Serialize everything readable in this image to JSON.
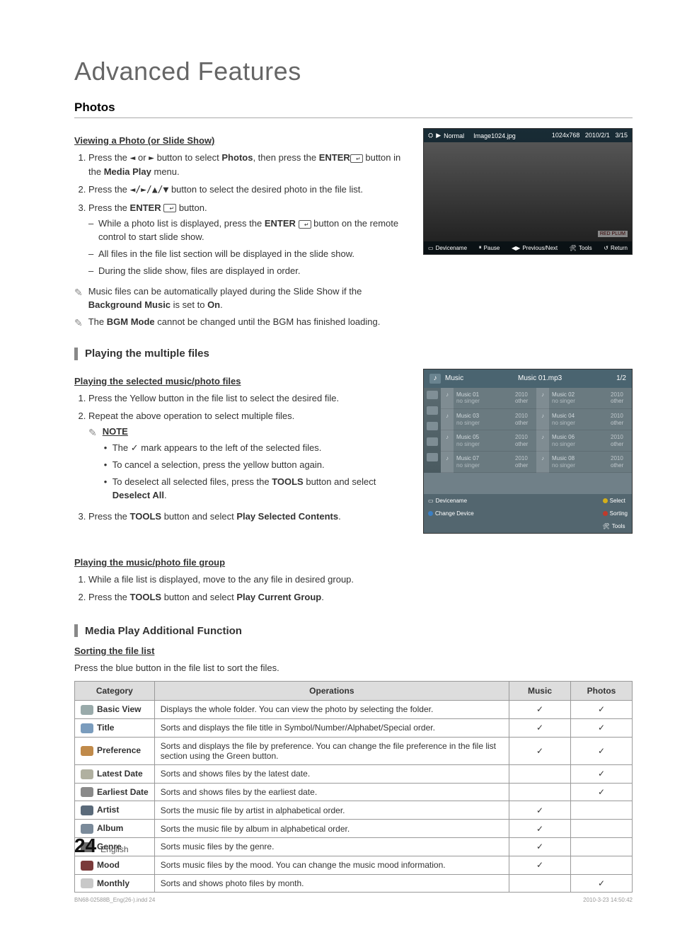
{
  "page": {
    "main_title": "Advanced Features",
    "number": "24",
    "lang": "English",
    "micro_left": "BN68-02588B_Eng(26-).indd   24",
    "micro_right": "2010-3-23   14:50:42"
  },
  "photos": {
    "heading": "Photos",
    "view_heading": "Viewing a Photo (or Slide Show)",
    "step1_a": "Press the ",
    "step1_b": " or ",
    "step1_c": " button to select ",
    "step1_d": "Photos",
    "step1_e": ", then press the ",
    "step1_f": "ENTER",
    "step1_g": " button in the ",
    "step1_h": "Media Play",
    "step1_i": " menu.",
    "step2_a": "Press the ",
    "step2_b": " button to select the desired photo in the file list.",
    "step3_a": "Press the ",
    "step3_b": "ENTER",
    "step3_c": " button.",
    "dash1_a": "While a photo list is displayed, press the ",
    "dash1_b": "ENTER",
    "dash1_c": " button on the remote control to start slide show.",
    "dash2": "All files in the file list section will be displayed in the slide show.",
    "dash3": "During the slide show, files are displayed in order.",
    "note1_a": "Music files can be automatically played during the Slide Show if the ",
    "note1_b": "Background Music",
    "note1_c": " is set to ",
    "note1_d": "On",
    "note1_e": ".",
    "note2_a": "The ",
    "note2_b": "BGM Mode",
    "note2_c": " cannot be changed until the BGM has finished loading."
  },
  "multi": {
    "heading": "Playing the multiple files",
    "sel_heading": "Playing the selected music/photo files",
    "step1": "Press the Yellow button in the file list to select the desired file.",
    "step2": "Repeat the above operation to select multiple files.",
    "note_label": "NOTE",
    "bullet1_a": "The ",
    "bullet1_b": " mark appears to the left of the selected files.",
    "bullet2": "To cancel a selection, press the yellow button again.",
    "bullet3_a": "To deselect all selected files, press the ",
    "bullet3_b": "TOOLS",
    "bullet3_c": " button and select ",
    "bullet3_d": "Deselect All",
    "bullet3_e": ".",
    "step3_a": "Press the ",
    "step3_b": "TOOLS",
    "step3_c": " button and select ",
    "step3_d": "Play Selected Contents",
    "step3_e": ".",
    "group_heading": "Playing the music/photo file group",
    "g_step1": "While a file list is displayed, move to the any file in desired group.",
    "g_step2_a": "Press the ",
    "g_step2_b": "TOOLS",
    "g_step2_c": " button and select ",
    "g_step2_d": "Play Current Group",
    "g_step2_e": "."
  },
  "additional": {
    "heading": "Media Play Additional Function",
    "sort_heading": "Sorting the file list",
    "sort_text": "Press the blue button in the file list to sort the files.",
    "table": {
      "headers": [
        "Category",
        "Operations",
        "Music",
        "Photos"
      ],
      "rows": [
        {
          "cat": "Basic View",
          "op": "Displays the whole folder. You can view the photo by selecting the folder.",
          "music": "✓",
          "photos": "✓",
          "icon_color": "#9aa"
        },
        {
          "cat": "Title",
          "op": "Sorts and displays the file title in Symbol/Number/Alphabet/Special order.",
          "music": "✓",
          "photos": "✓",
          "icon_color": "#7a9cbd"
        },
        {
          "cat": "Preference",
          "op": "Sorts and displays the file by preference. You can change the file preference in the file list section using the Green button.",
          "music": "✓",
          "photos": "✓",
          "icon_color": "#c08a4a"
        },
        {
          "cat": "Latest Date",
          "op": "Sorts and shows files by the latest date.",
          "music": "",
          "photos": "✓",
          "icon_color": "#b0b0a0"
        },
        {
          "cat": "Earliest Date",
          "op": "Sorts and shows files by the earliest date.",
          "music": "",
          "photos": "✓",
          "icon_color": "#8a8a8a"
        },
        {
          "cat": "Artist",
          "op": "Sorts the music file by artist in alphabetical order.",
          "music": "✓",
          "photos": "",
          "icon_color": "#5a6a7a"
        },
        {
          "cat": "Album",
          "op": "Sorts the music file by album in alphabetical order.",
          "music": "✓",
          "photos": "",
          "icon_color": "#7a8a9a"
        },
        {
          "cat": "Genre",
          "op": "Sorts music files by the genre.",
          "music": "✓",
          "photos": "",
          "icon_color": "#6a6a6a"
        },
        {
          "cat": "Mood",
          "op": "Sorts music files by the mood. You can change the music mood information.",
          "music": "✓",
          "photos": "",
          "icon_color": "#7a3a3a"
        },
        {
          "cat": "Monthly",
          "op": "Sorts and shows photo files by month.",
          "music": "",
          "photos": "✓",
          "icon_color": "#c8c8c8"
        }
      ]
    }
  },
  "photo_preview": {
    "mode": "Normal",
    "filename": "Image1024.jpg",
    "resolution": "1024x768",
    "date": "2010/2/1",
    "position": "3/15",
    "label": "RED PLUM",
    "devicename": "Devicename",
    "pause": "Pause",
    "prevnext": "Previous/Next",
    "tools": "Tools",
    "return": "Return"
  },
  "music_preview": {
    "title": "Music",
    "current": "Music 01.mp3",
    "page": "1/2",
    "items": [
      {
        "name": "Music 01",
        "artist": "no singer",
        "year": "2010",
        "genre": "other"
      },
      {
        "name": "Music 02",
        "artist": "no singer",
        "year": "2010",
        "genre": "other"
      },
      {
        "name": "Music 03",
        "artist": "no singer",
        "year": "2010",
        "genre": "other"
      },
      {
        "name": "Music 04",
        "artist": "no singer",
        "year": "2010",
        "genre": "other"
      },
      {
        "name": "Music 05",
        "artist": "no singer",
        "year": "2010",
        "genre": "other"
      },
      {
        "name": "Music 06",
        "artist": "no singer",
        "year": "2010",
        "genre": "other"
      },
      {
        "name": "Music 07",
        "artist": "no singer",
        "year": "2010",
        "genre": "other"
      },
      {
        "name": "Music 08",
        "artist": "no singer",
        "year": "2010",
        "genre": "other"
      }
    ],
    "devicename": "Devicename",
    "change_device": "Change Device",
    "select": "Select",
    "sorting": "Sorting",
    "tools": "Tools"
  }
}
